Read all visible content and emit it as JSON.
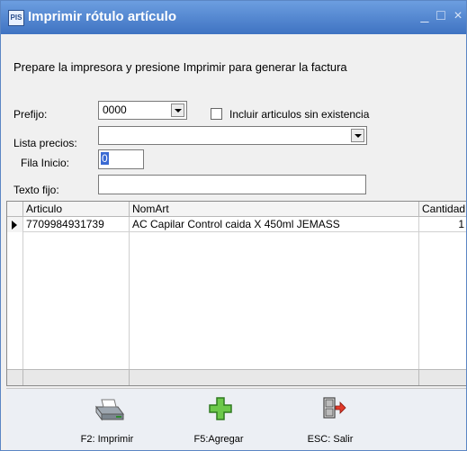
{
  "window": {
    "title": "Imprimir rótulo artículo",
    "icon_text": "PIS"
  },
  "description": "Prepare la impresora y presione Imprimir para generar la factura",
  "form": {
    "prefijo_label": "Prefijo:",
    "prefijo_value": "0000",
    "incluir_label": "Incluir articulos sin existencia",
    "incluir_checked": false,
    "lista_label": "Lista precios:",
    "lista_value": "",
    "fila_label": "Fila Inicio:",
    "fila_value": "0",
    "texto_label": "Texto fijo:",
    "texto_value": ""
  },
  "grid": {
    "columns": [
      "Articulo",
      "NomArt",
      "Cantidad"
    ],
    "rows": [
      {
        "articulo": "7709984931739",
        "nomart": "AC Capilar Control caida X 450ml JEMASS",
        "cantidad": "1"
      }
    ]
  },
  "toolbar": {
    "print_label": "F2: Imprimir",
    "add_label": "F5:Agregar",
    "exit_label": "ESC: Salir"
  }
}
